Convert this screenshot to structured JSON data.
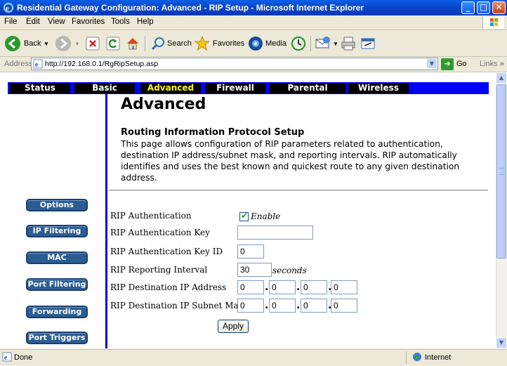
{
  "window": {
    "title": "Residential Gateway Configuration: Advanced - RIP Setup - Microsoft Internet Explorer",
    "minimize": "_",
    "maximize": "□",
    "close": "✕"
  },
  "menu": [
    "File",
    "Edit",
    "View",
    "Favorites",
    "Tools",
    "Help"
  ],
  "toolbar": {
    "back": "Back",
    "search": "Search",
    "favorites": "Favorites",
    "media": "Media"
  },
  "address": {
    "label": "Address",
    "url": "http://192.168.0.1/RgRipSetup.asp",
    "go": "Go",
    "links": "Links",
    "links_chevron": "»"
  },
  "nav": {
    "tabs": [
      "Status",
      "Basic",
      "Advanced",
      "Firewall",
      "Parental Control",
      "Wireless"
    ],
    "active": "Advanced"
  },
  "sidebar": {
    "items": [
      "Options",
      "IP Filtering",
      "MAC Filtering",
      "Port Filtering",
      "Forwarding",
      "Port Triggers"
    ]
  },
  "page": {
    "title": "Advanced",
    "section_title": "Routing Information Protocol Setup",
    "description": "This page allows configuration of RIP parameters related to authentication, destination IP address/subnet mask, and reporting intervals.  RIP automatically identifies and uses the best known and quickest route to any given destination address."
  },
  "form": {
    "auth_label": "RIP Authentication",
    "enable_label": "Enable",
    "enable_checked": true,
    "auth_key_label": "RIP Authentication Key",
    "auth_key_value": "",
    "auth_key_id_label": "RIP Authentication Key ID",
    "auth_key_id_value": "0",
    "interval_label": "RIP Reporting Interval",
    "interval_value": "30",
    "interval_unit": "seconds",
    "dest_ip_label": "RIP Destination IP Address",
    "dest_ip": [
      "0",
      "0",
      "0",
      "0"
    ],
    "dest_mask_label": "RIP Destination IP Subnet Mask",
    "dest_mask": [
      "0",
      "0",
      "0",
      "0"
    ],
    "ip_separator": ".",
    "apply": "Apply"
  },
  "status": {
    "text": "Done",
    "zone": "Internet"
  },
  "colors": {
    "nav_bar": "#0000ff",
    "nav_active": "#ffff00",
    "sidebar_button": "#2b5d93",
    "title_bar": "#0a46c9"
  }
}
